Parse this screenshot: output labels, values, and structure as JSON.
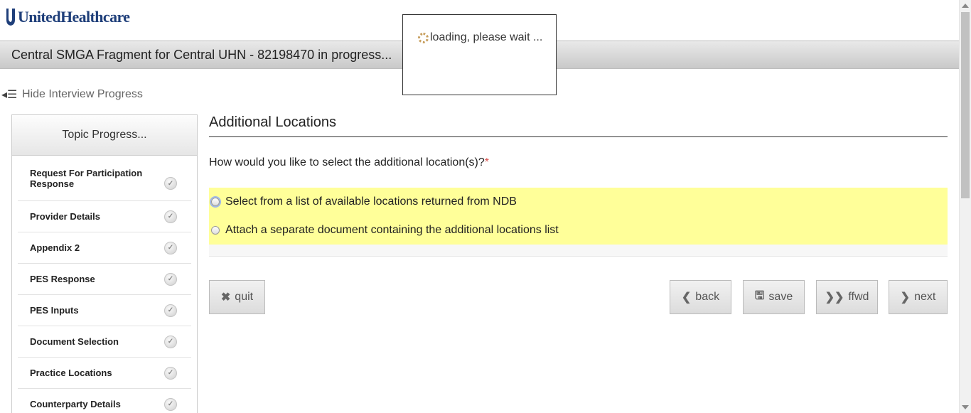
{
  "brand": {
    "logo_text": "UnitedHealthcare"
  },
  "title_bar": {
    "text": "Central SMGA Fragment for Central UHN - 82198470 in progress..."
  },
  "loading": {
    "text": "loading, please wait ..."
  },
  "hide_progress": {
    "label": "Hide Interview Progress"
  },
  "sidebar": {
    "header": "Topic Progress...",
    "items": [
      {
        "label": "Request For Participation Response"
      },
      {
        "label": "Provider Details"
      },
      {
        "label": "Appendix 2"
      },
      {
        "label": "PES Response"
      },
      {
        "label": "PES Inputs"
      },
      {
        "label": "Document Selection"
      },
      {
        "label": "Practice Locations"
      },
      {
        "label": "Counterparty Details"
      }
    ]
  },
  "main": {
    "section_title": "Additional Locations",
    "question": "How would you like to select the additional location(s)?",
    "required_mark": "*",
    "options": [
      {
        "label": "Select from a list of available locations returned from NDB"
      },
      {
        "label": "Attach a separate document containing the additional locations list"
      }
    ]
  },
  "buttons": {
    "quit": "quit",
    "back": "back",
    "save": "save",
    "ffwd": "ffwd",
    "next": "next"
  },
  "colors": {
    "options_highlight": "#ffff99",
    "brand_blue": "#1f3f7a",
    "required": "#d9534f"
  }
}
